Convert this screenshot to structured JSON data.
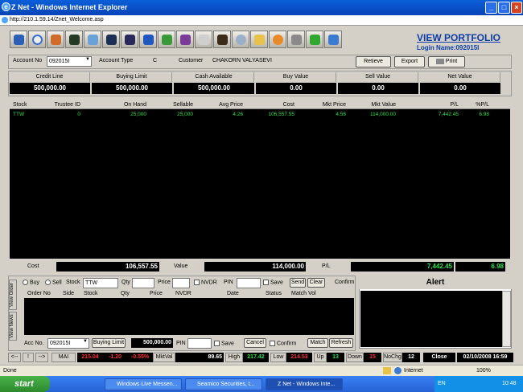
{
  "window": {
    "title": "Z Net - Windows Internet Explorer",
    "url": "http://210.1.59.14/Znet_Welcome.asp"
  },
  "header": {
    "view_portfolio": "VIEW PORTFOLIO",
    "login_name": "Login Name:092015I"
  },
  "account": {
    "account_no_label": "Account No",
    "account_no": "092015I",
    "account_type_label": "Account Type",
    "account_type": "C",
    "customer_label": "Customer",
    "customer": "CHAKORN VALYASEVI",
    "retieve_label": "Retieve",
    "export_label": "Export",
    "print_label": "Print"
  },
  "summary": {
    "headers": [
      "Credit Line",
      "Buying Limit",
      "Cash Available",
      "Buy Value",
      "Sell Value",
      "Net Value"
    ],
    "values": [
      "500,000.00",
      "500,000.00",
      "500,000.00",
      "0.00",
      "0.00",
      "0.00"
    ]
  },
  "grid": {
    "headers": [
      "Stock",
      "Trustee ID",
      "On Hand",
      "Sellable",
      "Avg Price",
      "Cost",
      "Mkt Price",
      "Mkt Value",
      "P/L",
      "%P/L"
    ],
    "row": [
      "TTW",
      "0",
      "25,000",
      "25,000",
      "4.26",
      "106,557.55",
      "4.56",
      "114,000.00",
      "7,442.45",
      "6.98"
    ]
  },
  "totals": {
    "cost_label": "Cost",
    "cost": "106,557.55",
    "value_label": "Value",
    "value": "114,000.00",
    "pl_label": "P/L",
    "pl": "7,442.45",
    "pct": "6.98"
  },
  "order": {
    "buy": "Buy",
    "sell": "Sell",
    "stock_label": "Stock",
    "stock": "TTW",
    "qty_label": "Qty",
    "price_label": "Price",
    "nvdr": "NVDR",
    "pin_label": "PIN",
    "save": "Save",
    "send": "Send",
    "clear": "Clear",
    "confirm": "Confirm",
    "grid_headers": [
      "Order No",
      "Side",
      "Stock",
      "Qty",
      "Price",
      "NVDR",
      "Date",
      "Status",
      "Match Vol"
    ],
    "acc_no_label": "Acc No.",
    "acc_no": "092015I",
    "buying_limit_label": "Buying Limit",
    "buying_limit": "500,000.00",
    "pin2_label": "PIN",
    "save2": "Save",
    "cancel": "Cancel",
    "confirm2": "Confirm",
    "match": "Match",
    "refresh": "Refresh",
    "tab_view_order": "View Order",
    "tab_view_news": "View News"
  },
  "alert": {
    "title": "Alert"
  },
  "ticker": {
    "prev": "<--",
    "bang": "!",
    "next": "-->",
    "mai_label": "MAI",
    "mai": "215.04",
    "mai_chg": "-1.20",
    "mai_pct": "-0.55%",
    "mktval_label": "MktVal",
    "mktval": "89.65",
    "high_label": "High",
    "high": "217.42",
    "low_label": "Low",
    "low": "214.53",
    "up_label": "Up",
    "up": "13",
    "down_label": "Down",
    "down": "15",
    "nochg_label": "NoChg",
    "nochg": "12",
    "status": "Close",
    "datetime": "02/10/2008 16:59"
  },
  "statusbar": {
    "left": "Done",
    "zone": "Internet",
    "zoom": "100%"
  },
  "taskbar": {
    "start": "start",
    "tasks": [
      "Windows Live Messen...",
      "Seamico Securities, t...",
      "Z Net - Windows Inte..."
    ],
    "lang": "EN",
    "time": "10:48"
  },
  "colors": {
    "green_text": "#2ee04a",
    "red_text": "#ff3030",
    "link_blue": "#0b3ea8"
  }
}
